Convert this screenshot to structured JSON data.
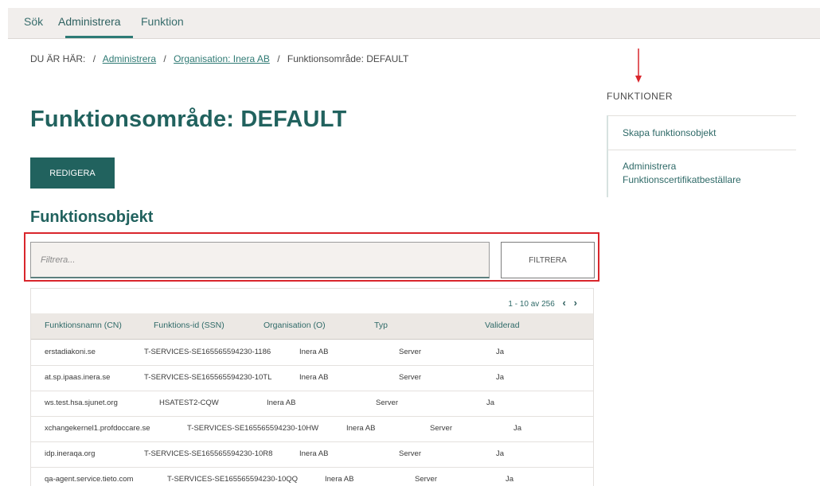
{
  "nav": {
    "tabs": [
      {
        "label": "Sök"
      },
      {
        "label": "Administrera"
      },
      {
        "label": "Funktion"
      }
    ],
    "active_tab": "Administrera"
  },
  "breadcrumb": {
    "prefix": "DU ÄR HÄR:",
    "items": [
      "Administrera",
      "Organisation: Inera AB",
      "Funktionsområde: DEFAULT"
    ],
    "separator": "/"
  },
  "page_title": "Funktionsområde: DEFAULT",
  "edit_button": "REDIGERA",
  "section_title": "Funktionsobjekt",
  "filter": {
    "placeholder": "Filtrera...",
    "button": "FILTRERA"
  },
  "table": {
    "pager": "1 - 10 av 256",
    "columns": [
      "Funktionsnamn (CN)",
      "Funktions-id (SSN)",
      "Organisation (O)",
      "Typ",
      "Validerad"
    ],
    "rows": [
      [
        "erstadiakoni.se",
        "T-SERVICES-SE165565594230-1186",
        "Inera AB",
        "Server",
        "Ja"
      ],
      [
        "at.sp.ipaas.inera.se",
        "T-SERVICES-SE165565594230-10TL",
        "Inera AB",
        "Server",
        "Ja"
      ],
      [
        "ws.test.hsa.sjunet.org",
        "HSATEST2-CQW",
        "Inera AB",
        "Server",
        "Ja"
      ],
      [
        "xchangekernel1.profdoccare.se",
        "T-SERVICES-SE165565594230-10HW",
        "Inera AB",
        "Server",
        "Ja"
      ],
      [
        "idp.ineraqa.org",
        "T-SERVICES-SE165565594230-10R8",
        "Inera AB",
        "Server",
        "Ja"
      ],
      [
        "qa-agent.service.tieto.com",
        "T-SERVICES-SE165565594230-10QQ",
        "Inera AB",
        "Server",
        "Ja"
      ]
    ]
  },
  "sidebar": {
    "title": "FUNKTIONER",
    "items": [
      {
        "label": "Skapa funktionsobjekt"
      },
      {
        "label_line1": "Administrera",
        "label_line2": "Funktionscertifikatbeställare"
      }
    ]
  },
  "colors": {
    "accent": "#21625e",
    "highlight": "#d9262c"
  }
}
